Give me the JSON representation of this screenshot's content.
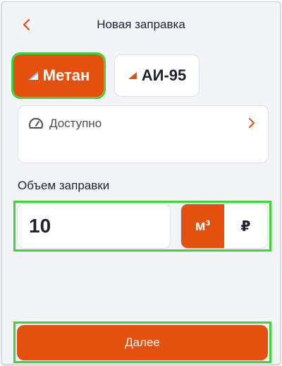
{
  "header": {
    "title": "Новая заправка",
    "back_icon": "chevron-left-icon"
  },
  "fuel_types": [
    {
      "label": "Метан",
      "selected": true,
      "icon": "fuel-flag-icon"
    },
    {
      "label": "АИ-95",
      "selected": false,
      "icon": "fuel-flag-icon"
    }
  ],
  "available": {
    "label": "Доступно",
    "icon": "gauge-icon",
    "chevron": "chevron-right-icon"
  },
  "volume": {
    "label": "Объем заправки",
    "value": "10",
    "units": [
      {
        "label": "м³",
        "selected": true
      },
      {
        "label": "₽",
        "selected": false
      }
    ]
  },
  "actions": {
    "next_label": "Далее"
  },
  "colors": {
    "accent": "#e4500e",
    "highlight": "#3fd43a",
    "background": "#f3f4f8"
  }
}
